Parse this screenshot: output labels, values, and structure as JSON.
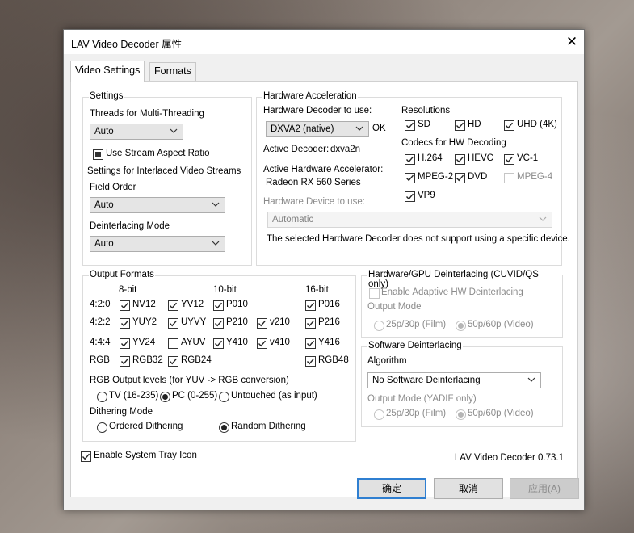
{
  "window": {
    "title": "LAV Video Decoder 属性",
    "close_glyph": "✕"
  },
  "tabs": [
    "Video Settings",
    "Formats"
  ],
  "settings": {
    "title": "Settings",
    "threads_label": "Threads for Multi-Threading",
    "threads_value": "Auto",
    "stream_aspect_label": "Use Stream Aspect Ratio",
    "interlaced_label": "Settings for Interlaced Video Streams",
    "field_order_label": "Field Order",
    "field_order_value": "Auto",
    "deint_mode_label": "Deinterlacing Mode",
    "deint_mode_value": "Auto"
  },
  "hwaccel": {
    "title": "Hardware Acceleration",
    "decoder_label": "Hardware Decoder to use:",
    "decoder_value": "DXVA2 (native)",
    "decoder_status": "OK",
    "active_decoder_label": "Active Decoder:",
    "active_decoder_value": "dxva2n",
    "active_accel_label": "Active Hardware Accelerator:",
    "active_accel_value": "Radeon RX 560 Series",
    "device_label": "Hardware Device to use:",
    "device_value": "Automatic",
    "note": "The selected Hardware Decoder does not support using a specific device.",
    "resolutions_title": "Resolutions",
    "resolutions": [
      "SD",
      "HD",
      "UHD (4K)"
    ],
    "codecs_title": "Codecs for HW Decoding",
    "codecs": [
      "H.264",
      "HEVC",
      "VC-1",
      "MPEG-2",
      "DVD",
      "MPEG-4",
      "VP9"
    ]
  },
  "output_formats": {
    "title": "Output Formats",
    "depth_headers": [
      "8-bit",
      "10-bit",
      "16-bit"
    ],
    "row_labels": [
      "4:2:0",
      "4:2:2",
      "4:4:4",
      "RGB"
    ],
    "formats": [
      "NV12",
      "YV12",
      "P010",
      "P016",
      "YUY2",
      "UYVY",
      "P210",
      "v210",
      "P216",
      "YV24",
      "AYUV",
      "Y410",
      "v410",
      "Y416",
      "RGB32",
      "RGB24",
      "RGB48"
    ],
    "rgb_levels_label": "RGB Output levels (for YUV -> RGB conversion)",
    "rgb_levels": [
      "TV (16-235)",
      "PC (0-255)",
      "Untouched (as input)"
    ],
    "dither_label": "Dithering Mode",
    "dither_options": [
      "Ordered Dithering",
      "Random Dithering"
    ]
  },
  "hw_deint": {
    "title": "Hardware/GPU Deinterlacing (CUVID/QS only)",
    "adaptive_label": "Enable Adaptive HW Deinterlacing",
    "output_mode_label": "Output Mode",
    "modes": [
      "25p/30p (Film)",
      "50p/60p (Video)"
    ]
  },
  "sw_deint": {
    "title": "Software Deinterlacing",
    "algorithm_label": "Algorithm",
    "algorithm_value": "No Software Deinterlacing",
    "output_mode_label": "Output Mode (YADIF only)",
    "modes": [
      "25p/30p (Film)",
      "50p/60p (Video)"
    ]
  },
  "footer": {
    "tray_label": "Enable System Tray Icon",
    "version": "LAV Video Decoder 0.73.1"
  },
  "buttons": {
    "ok": "确定",
    "cancel": "取消",
    "apply": "应用(A)"
  },
  "icons": [
    "close-icon",
    "dropdown-arrow-icon",
    "checkmark-icon",
    "radio-dot-icon"
  ],
  "colors": {
    "default_button_border": "#2f7fd1",
    "panel": "#f0f0f0",
    "content": "#ffffff"
  }
}
